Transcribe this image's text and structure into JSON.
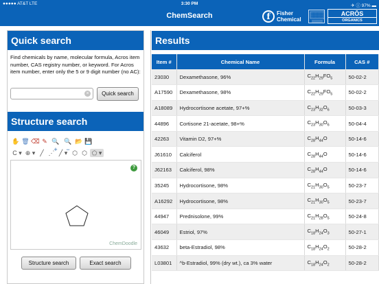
{
  "status": {
    "carrier": "●●●●● AT&T  LTE",
    "time": "3:30 PM",
    "battery": "✈ ⓘ 97% ▬"
  },
  "nav": {
    "title": "ChemSearch",
    "fisher_logo": "f",
    "fisher_text_1": "Fisher",
    "fisher_text_2": "Chemical",
    "acros_1": "ACRŌS",
    "acros_2": "ORGANICS"
  },
  "quick_search": {
    "header": "Quick search",
    "description": "Find chemicals by name, molecular formula, Acros item number, CAS registry number, or keyword. For Acros item number, enter only the 5 or 9 digit number (no AC):",
    "input_value": "",
    "input_placeholder": "",
    "button": "Quick search"
  },
  "structure_search": {
    "header": "Structure search",
    "toolbar1": [
      "✋",
      "🗑",
      "⌫",
      "✎",
      "🔍+",
      "🔍−",
      "📂",
      "💾"
    ],
    "toolbar2": [
      "C ▾",
      "⊕ ▾",
      "╱",
      "⋰",
      "╱ ▾",
      "⬡",
      "⬡",
      "⬠ ▾"
    ],
    "help": "?",
    "watermark": "ChemDoodle",
    "structure_button": "Structure search",
    "exact_button": "Exact search"
  },
  "results": {
    "header": "Results",
    "columns": [
      "Item #",
      "Chemical Name",
      "Formula",
      "CAS #"
    ],
    "rows": [
      {
        "item": "23030",
        "name": "Dexamethasone, 96%",
        "formula": "C<sub>22</sub>H<sub>29</sub>FO<sub>5</sub>",
        "cas": "50-02-2"
      },
      {
        "item": "A17590",
        "name": "Dexamethasone, 98%",
        "formula": "C<sub>22</sub>H<sub>29</sub>FO<sub>5</sub>",
        "cas": "50-02-2"
      },
      {
        "item": "A18089",
        "name": "Hydrocortisone acetate, 97+%",
        "formula": "C<sub>23</sub>H<sub>32</sub>O<sub>6</sub>",
        "cas": "50-03-3"
      },
      {
        "item": "44896",
        "name": "Cortisone 21-acetate, 98+%",
        "formula": "C<sub>23</sub>H<sub>30</sub>O<sub>6</sub>",
        "cas": "50-04-4"
      },
      {
        "item": "42263",
        "name": "Vitamin D2, 97+%",
        "formula": "C<sub>28</sub>H<sub>44</sub>O",
        "cas": "50-14-6"
      },
      {
        "item": "J61610",
        "name": "Calciferol",
        "formula": "C<sub>28</sub>H<sub>44</sub>O",
        "cas": "50-14-6"
      },
      {
        "item": "J62163",
        "name": "Calciferol, 98%",
        "formula": "C<sub>28</sub>H<sub>44</sub>O",
        "cas": "50-14-6"
      },
      {
        "item": "35245",
        "name": "Hydrocortisone, 98%",
        "formula": "C<sub>21</sub>H<sub>30</sub>O<sub>5</sub>",
        "cas": "50-23-7"
      },
      {
        "item": "A16292",
        "name": "Hydrocortisone, 98%",
        "formula": "C<sub>21</sub>H<sub>30</sub>O<sub>5</sub>",
        "cas": "50-23-7"
      },
      {
        "item": "44947",
        "name": "Prednisolone, 99%",
        "formula": "C<sub>21</sub>H<sub>28</sub>O<sub>5</sub>",
        "cas": "50-24-8"
      },
      {
        "item": "46049",
        "name": "Estriol, 97%",
        "formula": "C<sub>18</sub>H<sub>24</sub>O<sub>3</sub>",
        "cas": "50-27-1"
      },
      {
        "item": "43632",
        "name": "beta-Estradiol, 98%",
        "formula": "C<sub>18</sub>H<sub>24</sub>O<sub>2</sub>",
        "cas": "50-28-2"
      },
      {
        "item": "L03801",
        "name": "^b-Estradiol, 99% (dry wt.), ca 3% water",
        "formula": "C<sub>18</sub>H<sub>24</sub>O<sub>2</sub>",
        "cas": "50-28-2"
      }
    ]
  }
}
